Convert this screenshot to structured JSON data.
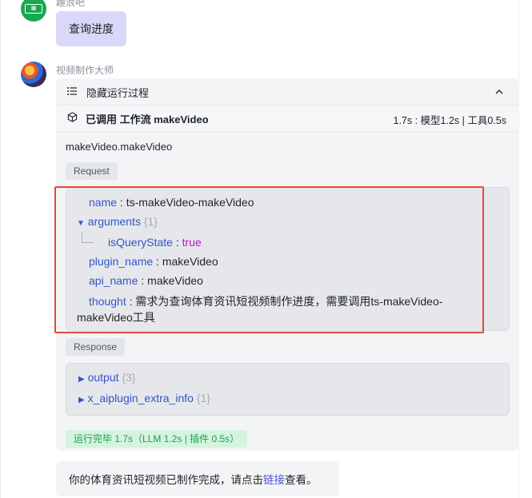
{
  "user": {
    "name": "趣浪吧",
    "message": "查询进度"
  },
  "bot": {
    "name": "视频制作大师",
    "hide_process_label": "隐藏运行过程",
    "tool_call": {
      "label": "已调用 工作流 makeVideo",
      "timing": "1.7s : 模型1.2s | 工具0.5s"
    },
    "function_name": "makeVideo.makeVideo",
    "request_label": "Request",
    "request": {
      "name_key": "name",
      "name_value": "ts-makeVideo-makeVideo",
      "arguments_key": "arguments",
      "arguments_count": "{1}",
      "isQueryState_key": "isQueryState",
      "isQueryState_value": "true",
      "plugin_name_key": "plugin_name",
      "plugin_name_value": "makeVideo",
      "api_name_key": "api_name",
      "api_name_value": "makeVideo",
      "thought_key": "thought",
      "thought_value_line1": "需求为查询体育资讯短视频制作进度，需要调用ts-makeVideo-",
      "thought_value_line2": "makeVideo工具"
    },
    "response_label": "Response",
    "response": {
      "output_key": "output",
      "output_count": "{3}",
      "extra_key": "x_aiplugin_extra_info",
      "extra_count": "{1}"
    },
    "status": "运行完毕 1.7s（LLM 1.2s | 插件 0.5s）",
    "answer": {
      "prefix": "你的体育资讯短视频已制作完成，请点击",
      "link": "链接",
      "suffix": "查看。"
    }
  },
  "colors": {
    "user_bubble": "#d9d8f8",
    "key": "#3355cc",
    "boolean": "#b01cc0",
    "status_green": "#16a34a",
    "highlight_red": "#e04a3c",
    "link": "#4b52d8"
  }
}
